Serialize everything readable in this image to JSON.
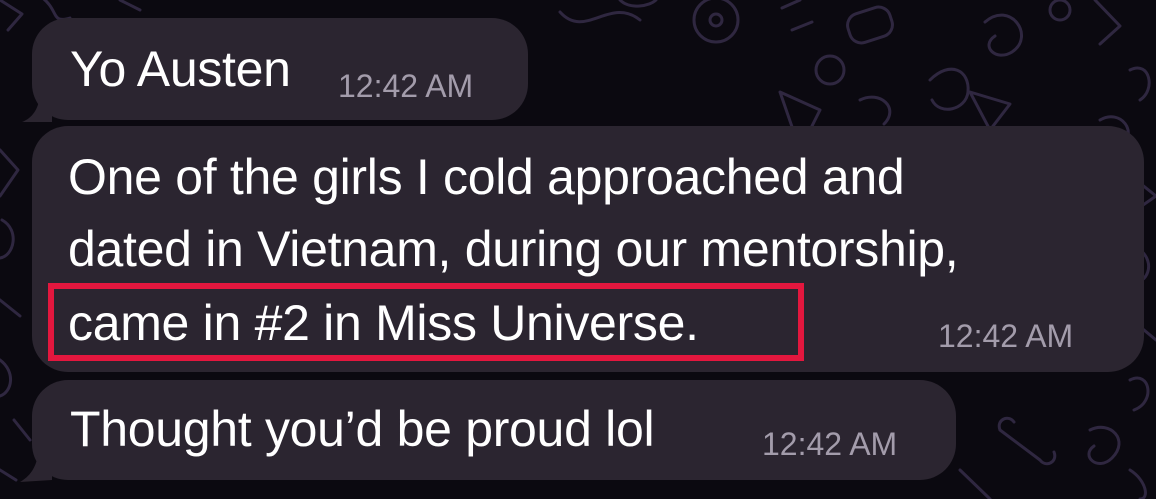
{
  "chat": {
    "messages": [
      {
        "lines": [
          "Yo Austen"
        ],
        "time": "12:42 AM"
      },
      {
        "lines": [
          "One of the girls I cold approached and",
          "dated in Vietnam, during our mentorship,",
          "came in #2 in Miss Universe."
        ],
        "time": "12:42 AM"
      },
      {
        "lines": [
          "Thought you’d be proud lol"
        ],
        "time": "12:42 AM"
      }
    ]
  },
  "colors": {
    "background": "#0b0910",
    "bubble": "#2b2530",
    "text": "#ffffff",
    "timestamp": "#a39cab",
    "highlight_box": "#e3173e",
    "wallpaper_doodles": "#2f2740"
  }
}
